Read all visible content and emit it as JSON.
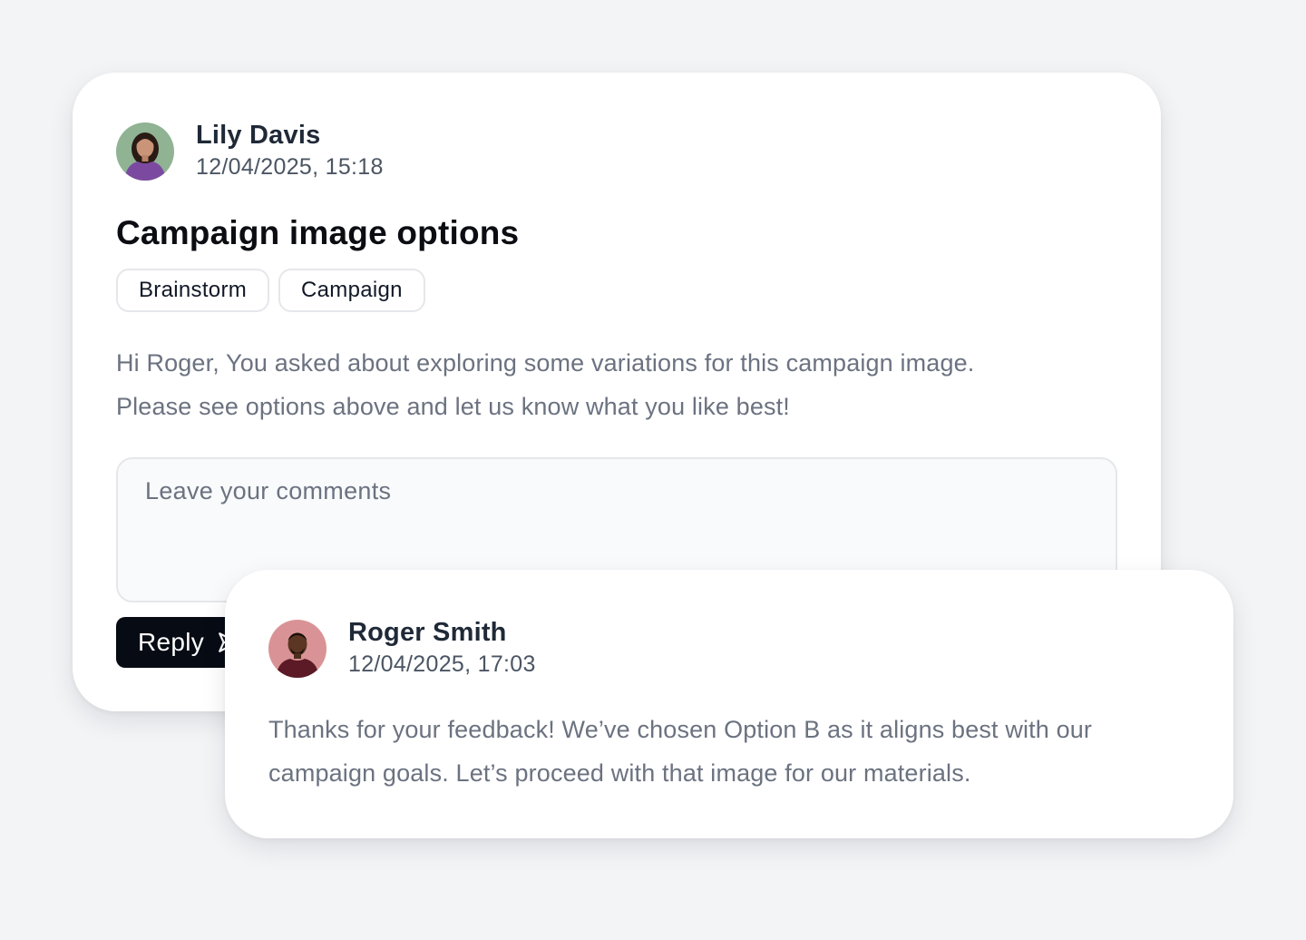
{
  "post": {
    "author": {
      "name": "Lily Davis",
      "timestamp": "12/04/2025, 15:18",
      "avatar_icon": "user-avatar-photo"
    },
    "title": "Campaign image options",
    "tags": [
      "Brainstorm",
      "Campaign"
    ],
    "body_line1": "Hi Roger, You asked about exploring some variations for this campaign image.",
    "body_line2": "Please see options above and let us know what you like best!",
    "comment": {
      "placeholder": "Leave your comments",
      "value": ""
    },
    "reply_button": {
      "label": "Reply",
      "icon": "send-icon"
    }
  },
  "reply": {
    "author": {
      "name": "Roger Smith",
      "timestamp": "12/04/2025, 17:03",
      "avatar_icon": "user-avatar-photo"
    },
    "body_line1": "Thanks for your feedback! We’ve chosen Option B as it aligns best with our",
    "body_line2": "campaign goals. Let’s proceed with that image for our materials."
  },
  "colors": {
    "page_background": "#f3f4f6",
    "card_background": "#ffffff",
    "button_background": "#060b14",
    "muted_text": "#6b7280",
    "heading_text": "#0b0d12"
  }
}
